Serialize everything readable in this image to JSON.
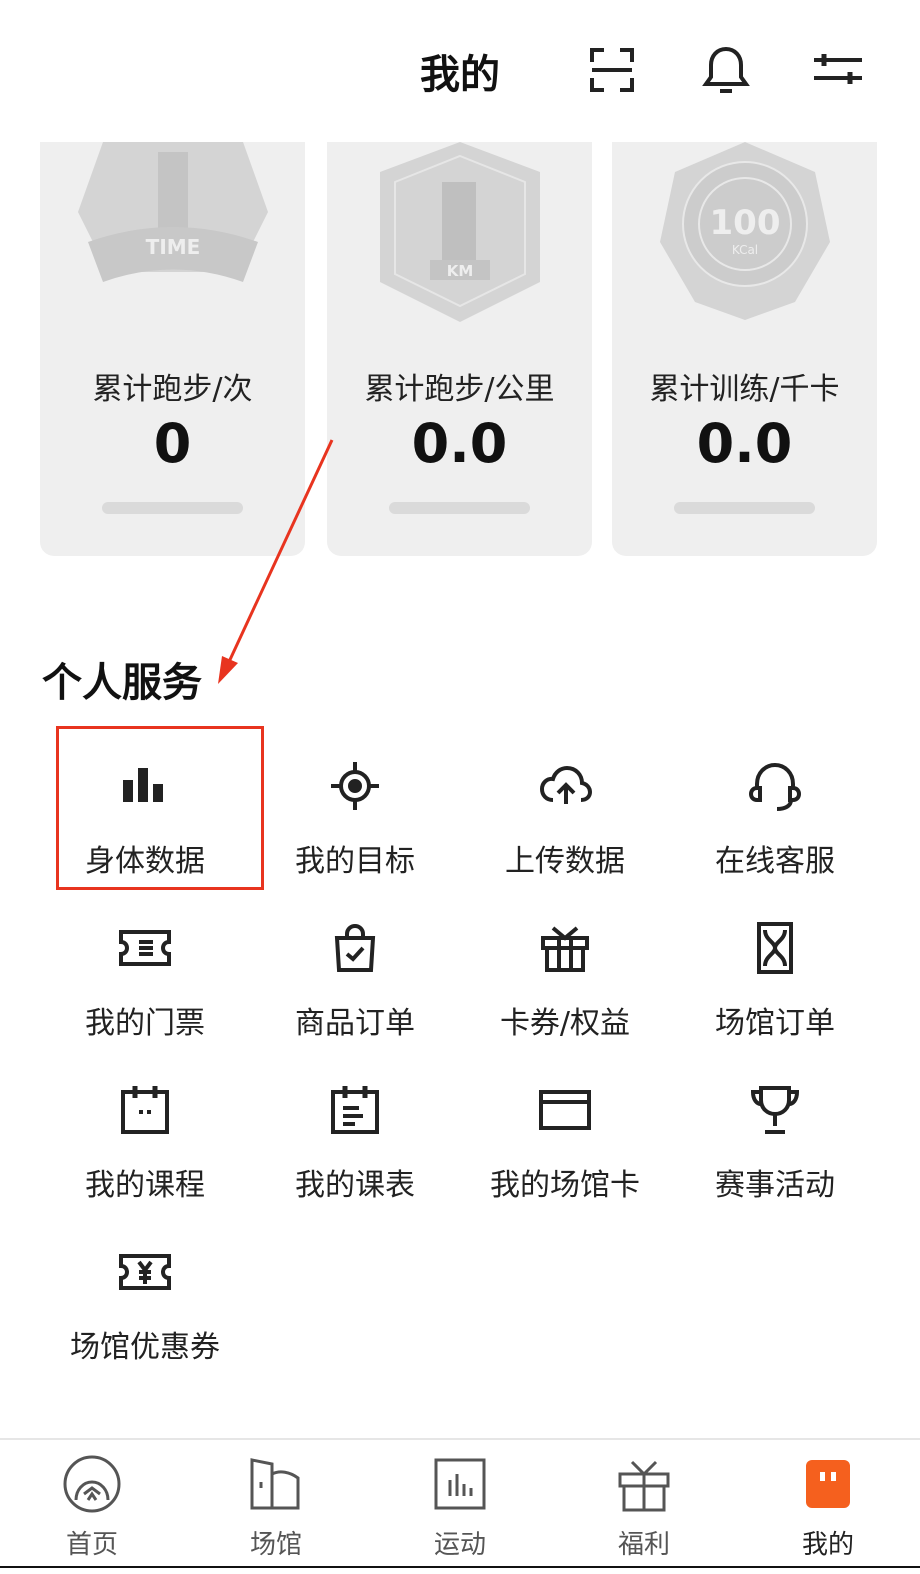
{
  "header": {
    "title": "我的",
    "icons": [
      "scan-icon",
      "bell-icon",
      "settings-sliders-icon"
    ]
  },
  "stats": [
    {
      "label": "累计跑步/次",
      "value": "0",
      "badge_text": "TIME",
      "badge_number": "1"
    },
    {
      "label": "累计跑步/公里",
      "value": "0.0",
      "badge_text": "KM",
      "badge_number": "1"
    },
    {
      "label": "累计训练/千卡",
      "value": "0.0",
      "badge_text": "KCal",
      "badge_number": "100"
    }
  ],
  "section": {
    "title": "个人服务"
  },
  "services": [
    {
      "label": "身体数据",
      "icon": "bar-chart-icon"
    },
    {
      "label": "我的目标",
      "icon": "target-icon"
    },
    {
      "label": "上传数据",
      "icon": "cloud-upload-icon"
    },
    {
      "label": "在线客服",
      "icon": "headset-icon"
    },
    {
      "label": "我的门票",
      "icon": "ticket-icon"
    },
    {
      "label": "商品订单",
      "icon": "shopping-bag-icon"
    },
    {
      "label": "卡券/权益",
      "icon": "gift-icon"
    },
    {
      "label": "场馆订单",
      "icon": "hourglass-icon"
    },
    {
      "label": "我的课程",
      "icon": "calendar-icon"
    },
    {
      "label": "我的课表",
      "icon": "schedule-icon"
    },
    {
      "label": "我的场馆卡",
      "icon": "card-icon"
    },
    {
      "label": "赛事活动",
      "icon": "trophy-icon"
    },
    {
      "label": "场馆优惠券",
      "icon": "coupon-icon"
    }
  ],
  "nav": [
    {
      "label": "首页",
      "icon": "home-icon"
    },
    {
      "label": "场馆",
      "icon": "venue-icon"
    },
    {
      "label": "运动",
      "icon": "sport-icon"
    },
    {
      "label": "福利",
      "icon": "gift-icon"
    },
    {
      "label": "我的",
      "icon": "profile-icon",
      "active": true
    }
  ],
  "colors": {
    "accent": "#f5601e",
    "annotation": "#e8341f",
    "card_bg": "#efefef",
    "badge": "#d4d4d4"
  }
}
